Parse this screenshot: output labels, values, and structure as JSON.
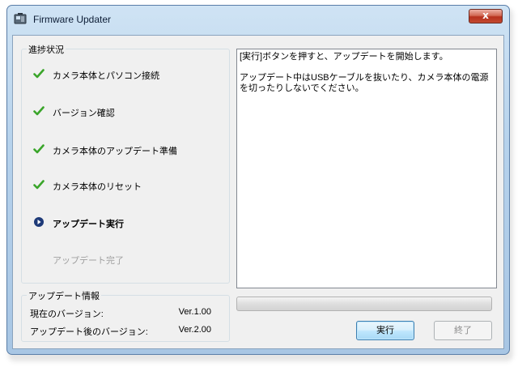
{
  "window": {
    "title": "Firmware Updater",
    "close_glyph": "x"
  },
  "progress_panel": {
    "label": "進捗状況",
    "steps": [
      {
        "label": "カメラ本体とパソコン接続",
        "status": "done"
      },
      {
        "label": "バージョン確認",
        "status": "done"
      },
      {
        "label": "カメラ本体のアップデート準備",
        "status": "done"
      },
      {
        "label": "カメラ本体のリセット",
        "status": "done"
      },
      {
        "label": "アップデート実行",
        "status": "current"
      },
      {
        "label": "アップデート完了",
        "status": "pending"
      }
    ]
  },
  "update_info": {
    "label": "アップデート情報",
    "current_version_label": "現在のバージョン:",
    "current_version": "Ver.1.00",
    "new_version_label": "アップデート後のバージョン:",
    "new_version": "Ver.2.00"
  },
  "message": {
    "line1": "[実行]ボタンを押すと、アップデートを開始します。",
    "line2": "アップデート中はUSBケーブルを抜いたり、カメラ本体の電源を切ったりしないでください。"
  },
  "progress": {
    "percent": 0
  },
  "buttons": {
    "execute": "実行",
    "exit": "終了"
  },
  "colors": {
    "check": "#3aa52a",
    "current": "#1e3a78"
  }
}
